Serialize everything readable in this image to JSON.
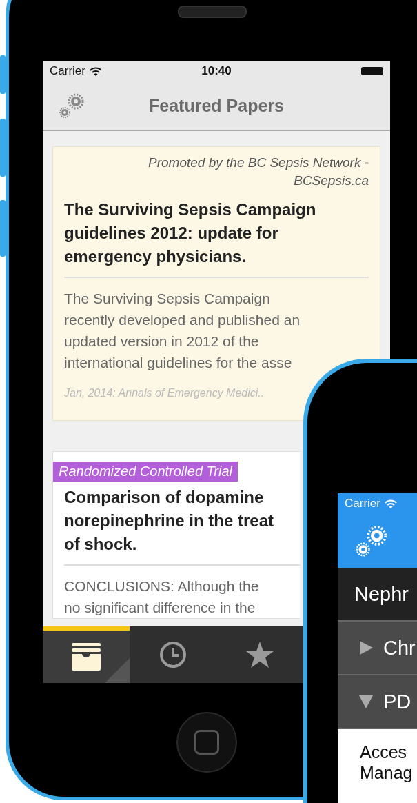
{
  "phone_1": {
    "status_bar": {
      "carrier": "Carrier",
      "time": "10:40"
    },
    "nav_bar": {
      "title": "Featured Papers"
    },
    "papers": [
      {
        "kind": "promoted",
        "promoted_by": [
          "Promoted by the BC Sepsis Network -",
          "BCSepsis.ca"
        ],
        "title_lines": [
          "The Surviving Sepsis Campaign",
          "guidelines 2012: update for",
          "emergency physicians."
        ],
        "abstract_lines": [
          "The Surviving Sepsis Campaign",
          "recently developed and published an",
          "updated version in 2012 of the",
          "international guidelines for the asse"
        ],
        "citation": "Jan, 2014: Annals of Emergency Medici.."
      },
      {
        "kind": "tagged",
        "tag": "Randomized Controlled Trial",
        "title_lines": [
          "Comparison of dopamine",
          "norepinephrine in the treat",
          "of shock."
        ],
        "abstract_lines": [
          "CONCLUSIONS: Although the",
          "no significant difference in the"
        ]
      }
    ],
    "tab_bar": [
      {
        "selected": true
      },
      {
        "selected": false
      },
      {
        "selected": false
      }
    ]
  },
  "phone_2": {
    "status_bar": {
      "carrier": "Carrier"
    },
    "section": "Nephr",
    "rows": [
      {
        "label": "Chr",
        "expanded": false
      },
      {
        "label": "PD",
        "expanded": true
      }
    ],
    "item_lines": [
      "Acces",
      "Manag"
    ]
  }
}
